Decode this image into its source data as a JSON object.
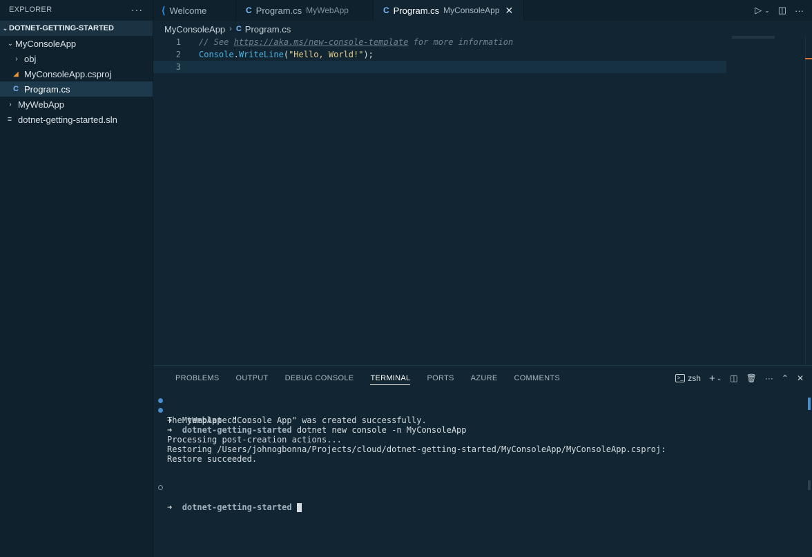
{
  "sidebar": {
    "title": "EXPLORER",
    "more": "···",
    "section": "DOTNET-GETTING-STARTED",
    "items": [
      {
        "label": "MyConsoleApp"
      },
      {
        "label": "obj"
      },
      {
        "label": "MyConsoleApp.csproj"
      },
      {
        "label": "Program.cs"
      },
      {
        "label": "MyWebApp"
      },
      {
        "label": "dotnet-getting-started.sln"
      }
    ]
  },
  "tabs": [
    {
      "label": "Welcome",
      "desc": ""
    },
    {
      "label": "Program.cs",
      "desc": "MyWebApp"
    },
    {
      "label": "Program.cs",
      "desc": "MyConsoleApp"
    }
  ],
  "breadcrumb": {
    "folder": "MyConsoleApp",
    "file": "Program.cs"
  },
  "editor": {
    "lines": [
      {
        "num": "1",
        "comment_pre": "// See ",
        "link": "https://aka.ms/new-console-template",
        "comment_post": " for more information"
      },
      {
        "num": "2",
        "class": "Console",
        "dot": ".",
        "method": "WriteLine",
        "open": "(",
        "str": "\"Hello, World!\"",
        "close": ");"
      },
      {
        "num": "3"
      }
    ]
  },
  "panel": {
    "tabs": [
      "PROBLEMS",
      "OUTPUT",
      "DEBUG CONSOLE",
      "TERMINAL",
      "PORTS",
      "AZURE",
      "COMMENTS"
    ],
    "shell": "zsh"
  },
  "terminal": {
    "lines": [
      {
        "arrow": "➜",
        "dir": "MyWebApp",
        "cmd": " cd .."
      },
      {
        "arrow": "➜",
        "dir": "dotnet-getting-started",
        "cmd": " dotnet new console -n MyConsoleApp"
      },
      {
        "text": "The template \"Console App\" was created successfully."
      },
      {
        "text": ""
      },
      {
        "text": "Processing post-creation actions..."
      },
      {
        "text": "Restoring /Users/johnogbonna/Projects/cloud/dotnet-getting-started/MyConsoleApp/MyConsoleApp.csproj:"
      },
      {
        "text": "Restore succeeded."
      },
      {
        "arrow": "➜",
        "dir": "dotnet-getting-started"
      }
    ]
  },
  "colors": {
    "background": "#112532",
    "sidebar": "#0f212d",
    "accent": "#4b8ed0"
  }
}
